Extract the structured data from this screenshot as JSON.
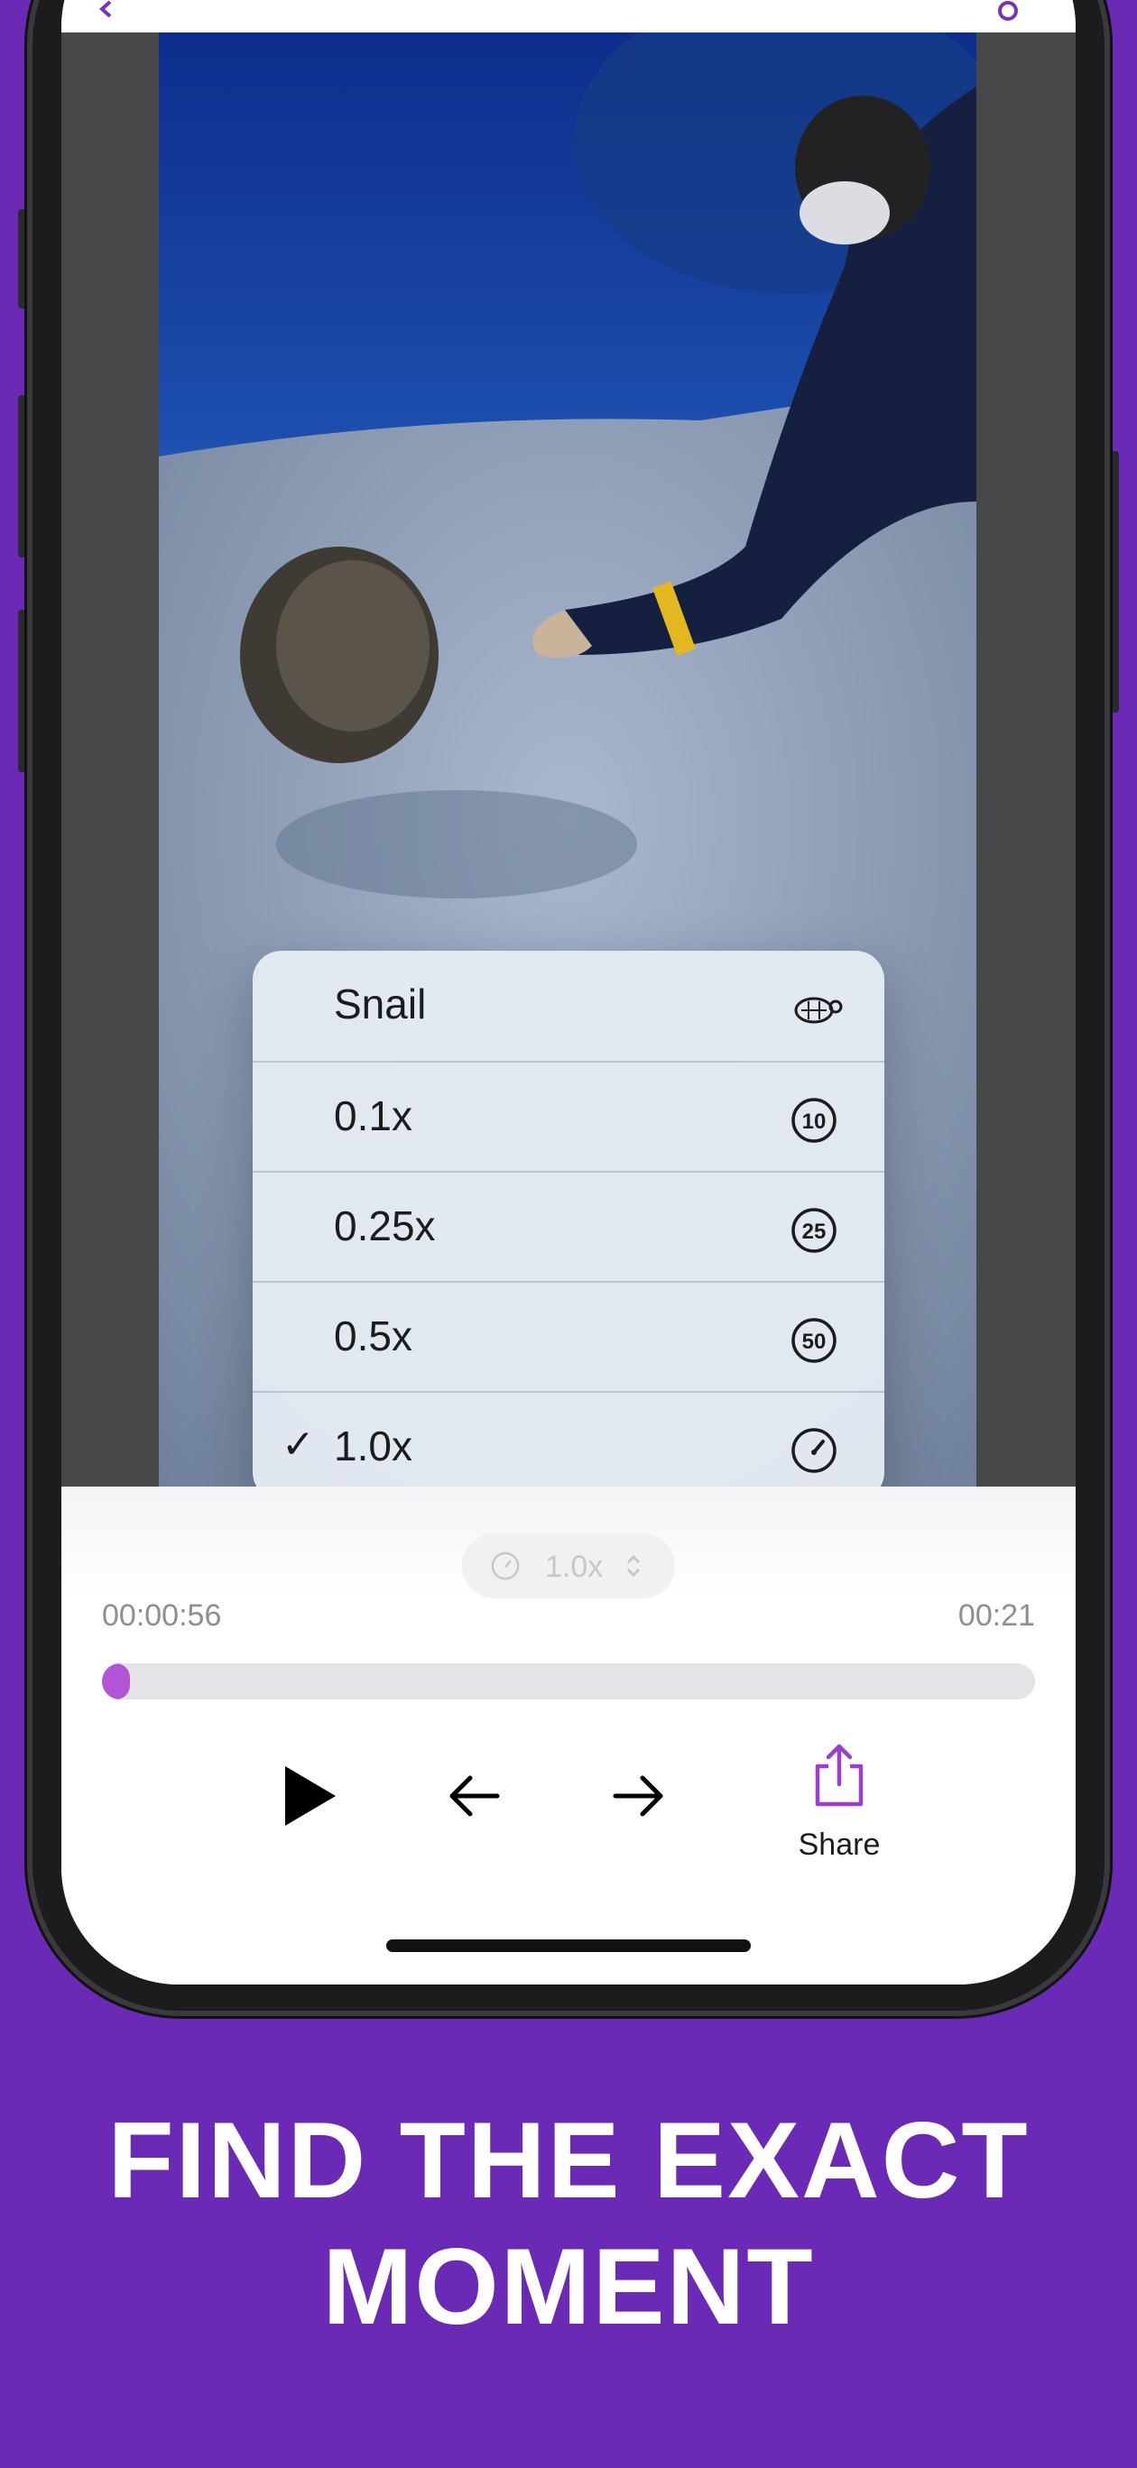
{
  "app": {
    "accent_color": "#b455d8",
    "background_color": "#6b2ab5"
  },
  "speed_menu": {
    "items": [
      {
        "label": "Snail",
        "icon": "turtle-icon",
        "selected": false
      },
      {
        "label": "0.1x",
        "icon": "circle-10-icon",
        "selected": false
      },
      {
        "label": "0.25x",
        "icon": "circle-25-icon",
        "selected": false
      },
      {
        "label": "0.5x",
        "icon": "circle-50-icon",
        "selected": false
      },
      {
        "label": "1.0x",
        "icon": "speedometer-icon",
        "selected": true
      }
    ],
    "check_mark": "✓"
  },
  "speed_pill": {
    "label": "1.0x",
    "icon": "speedometer-icon"
  },
  "playback": {
    "current_time": "00:00:56",
    "remaining_time": "00:21",
    "progress": 0.03
  },
  "toolbar": {
    "play": "play-icon",
    "back": "arrow-left-icon",
    "forward": "arrow-right-icon",
    "share_label": "Share",
    "share_icon": "share-icon"
  },
  "headline": {
    "line1": "FIND THE EXACT",
    "line2": "MOMENT"
  }
}
